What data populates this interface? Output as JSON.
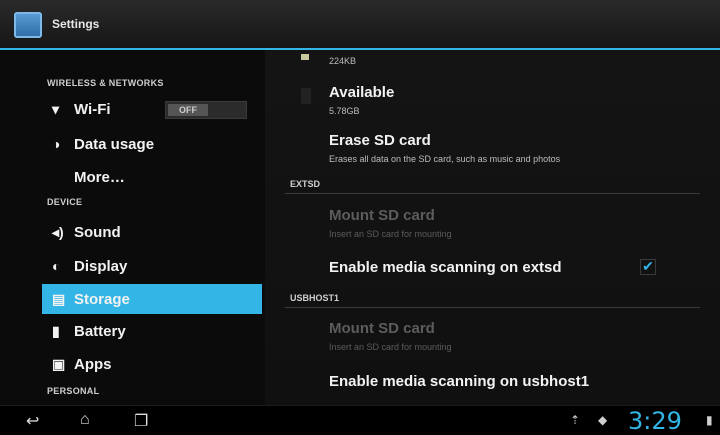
{
  "app": {
    "title": "Settings"
  },
  "sidebar": {
    "sections": [
      "WIRELESS & NETWORKS",
      "DEVICE",
      "PERSONAL"
    ],
    "items": [
      {
        "label": "Wi-Fi",
        "icon": "wifi-icon"
      },
      {
        "label": "Data usage",
        "icon": "data-usage-icon"
      },
      {
        "label": "More…",
        "icon": ""
      },
      {
        "label": "Sound",
        "icon": "sound-icon"
      },
      {
        "label": "Display",
        "icon": "display-icon"
      },
      {
        "label": "Storage",
        "icon": "storage-icon"
      },
      {
        "label": "Battery",
        "icon": "battery-icon"
      },
      {
        "label": "Apps",
        "icon": "apps-icon"
      }
    ],
    "wifi_toggle": "OFF"
  },
  "content": {
    "top_value": "224KB",
    "available": {
      "title": "Available",
      "value": "5.78GB"
    },
    "erase": {
      "title": "Erase SD card",
      "subtitle": "Erases all data on the SD card, such as music and photos"
    },
    "categories": [
      "EXTSD",
      "USBHOST1"
    ],
    "extsd": {
      "mount_title": "Mount SD card",
      "mount_sub": "Insert an SD card for mounting",
      "scan_title": "Enable media scanning on extsd",
      "scan_checked": true
    },
    "usbhost": {
      "mount_title": "Mount SD card",
      "mount_sub": "Insert an SD card for mounting",
      "scan_title": "Enable media scanning on usbhost1"
    }
  },
  "status": {
    "clock": "3:29"
  },
  "colors": {
    "accent": "#33b5e5"
  }
}
